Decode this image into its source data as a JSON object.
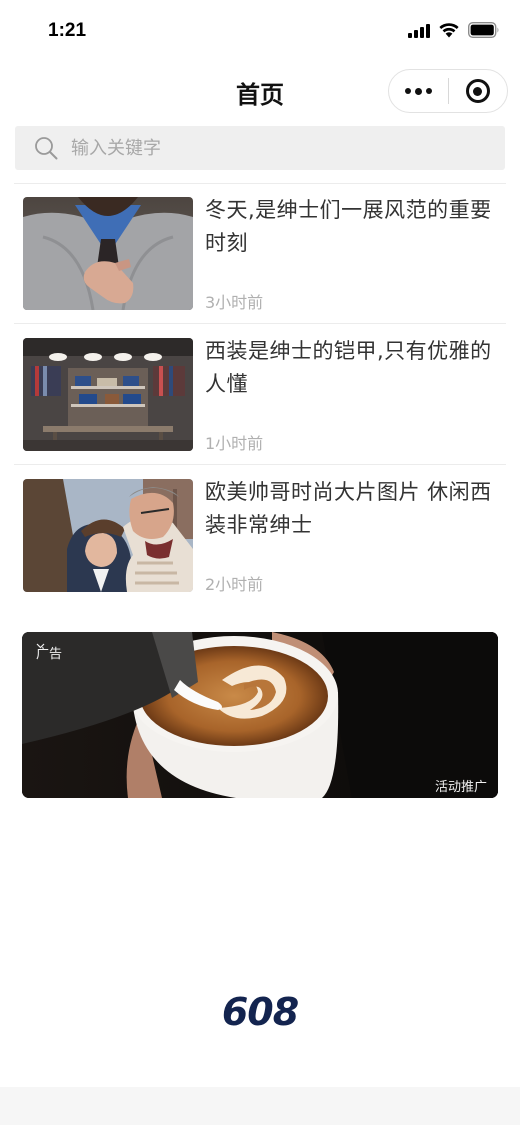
{
  "status_bar": {
    "time": "1:21"
  },
  "nav": {
    "title": "首页"
  },
  "search": {
    "placeholder": "输入关键字"
  },
  "articles": [
    {
      "title": "冬天,是绅士们一展风范的重要时刻",
      "time": "3小时前"
    },
    {
      "title": "西装是绅士的铠甲,只有优雅的人懂",
      "time": "1小时前"
    },
    {
      "title": "欧美帅哥时尚大片图片 休闲西装非常绅士",
      "time": "2小时前"
    }
  ],
  "ad": {
    "tag": "广告",
    "promo": "活动推广"
  },
  "footer": {
    "number": "608"
  }
}
